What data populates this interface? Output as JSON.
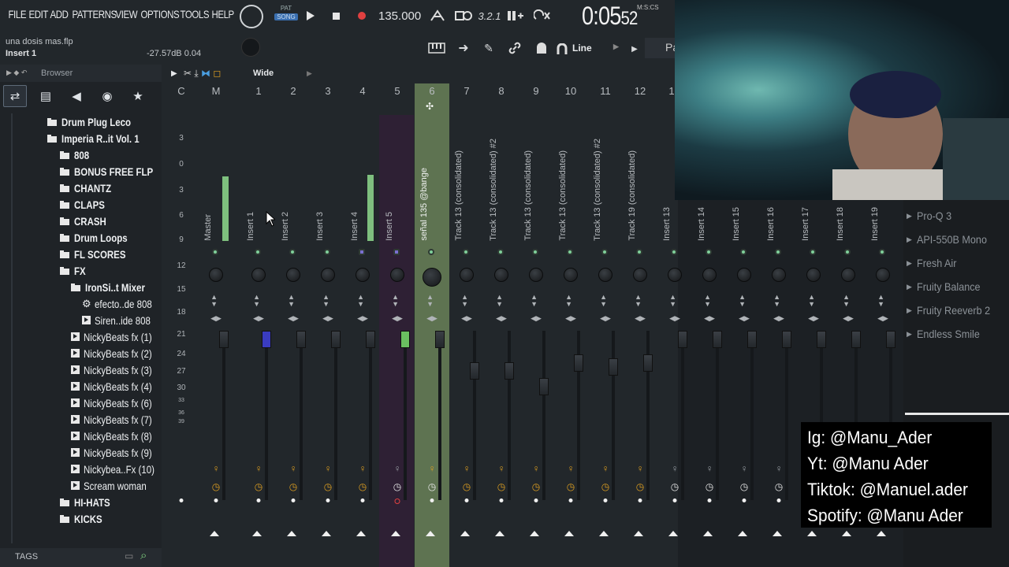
{
  "menu": [
    "FILE",
    "EDIT",
    "ADD",
    "PATTERNS",
    "VIEW",
    "OPTIONS",
    "TOOLS",
    "HELP"
  ],
  "transport": {
    "pat_label": "PAT",
    "song_label": "SONG",
    "tempo": "135.000",
    "time": "0:05",
    "time_sub": "52",
    "time_mode": "M:S:CS"
  },
  "hint": {
    "file": "una dosis mas.flp",
    "insert": "Insert 1",
    "db": "-27.57dB  0.04"
  },
  "toolbar2": {
    "snap": "Line",
    "truncated": "Pa"
  },
  "browser": {
    "title": "Browser",
    "items": [
      {
        "label": "Drum Plug Leco",
        "icon": "folder",
        "level": 1
      },
      {
        "label": "Imperia R..it Vol. 1",
        "icon": "folder",
        "level": 1
      },
      {
        "label": "808",
        "icon": "folder",
        "level": 2
      },
      {
        "label": "BONUS FREE FLP",
        "icon": "folder",
        "level": 2
      },
      {
        "label": "CHANTZ",
        "icon": "folder",
        "level": 2
      },
      {
        "label": "CLAPS",
        "icon": "folder",
        "level": 2
      },
      {
        "label": "CRASH",
        "icon": "folder",
        "level": 2
      },
      {
        "label": "Drum Loops",
        "icon": "folder",
        "level": 2
      },
      {
        "label": "FL SCORES",
        "icon": "folder",
        "level": 2
      },
      {
        "label": "FX",
        "icon": "folder",
        "level": 2
      },
      {
        "label": "IronSi..t Mixer",
        "icon": "folder",
        "level": 3
      },
      {
        "label": "efecto..de 808",
        "icon": "gear",
        "level": 4
      },
      {
        "label": "Siren..ide 808",
        "icon": "file",
        "level": 4
      },
      {
        "label": "NickyBeats fx (1)",
        "icon": "file",
        "level": 3
      },
      {
        "label": "NickyBeats fx (2)",
        "icon": "file",
        "level": 3
      },
      {
        "label": "NickyBeats fx (3)",
        "icon": "file",
        "level": 3
      },
      {
        "label": "NickyBeats fx (4)",
        "icon": "file",
        "level": 3
      },
      {
        "label": "NickyBeats fx (6)",
        "icon": "file",
        "level": 3
      },
      {
        "label": "NickyBeats fx (7)",
        "icon": "file",
        "level": 3
      },
      {
        "label": "NickyBeats fx (8)",
        "icon": "file",
        "level": 3
      },
      {
        "label": "NickyBeats fx (9)",
        "icon": "file",
        "level": 3
      },
      {
        "label": "Nickybea..Fx (10)",
        "icon": "file",
        "level": 3
      },
      {
        "label": "Scream woman",
        "icon": "file",
        "level": 3
      },
      {
        "label": "HI-HATS",
        "icon": "folder",
        "level": 2
      },
      {
        "label": "KICKS",
        "icon": "folder",
        "level": 2
      }
    ],
    "tags_label": "TAGS"
  },
  "mixer": {
    "view_mode": "Wide",
    "strip_numbers": [
      "C",
      "M",
      "1",
      "2",
      "3",
      "4",
      "5",
      "6",
      "7",
      "8",
      "9",
      "10",
      "11",
      "12",
      "1"
    ],
    "scale": [
      "3",
      "0",
      "3",
      "6",
      "9",
      "12",
      "15",
      "18",
      "21",
      "24",
      "27",
      "30",
      "33",
      "36",
      "39"
    ],
    "track_names": [
      "Master",
      "Insert 1",
      "Insert 2",
      "Insert 3",
      "Insert 4",
      "Insert 5",
      "señal 135 @bange",
      "Track 13 (consolidated)",
      "Track 13 (consolidated) #2",
      "Track 13 (consolidated)",
      "Track 13 (consolidated)",
      "Track 13 (consolidated) #2",
      "Track 19 (consolidated)",
      "Insert 13",
      "Insert 14",
      "Insert 15",
      "Insert 16",
      "Insert 17",
      "Insert 18",
      "Insert 19"
    ],
    "selected_strip": "6",
    "accent": "#5e7351"
  },
  "effects": [
    "Pro-Q 3",
    "API-550B Mono",
    "Fresh Air",
    "Fruity Balance",
    "Fruity Reeverb 2",
    "Endless Smile"
  ],
  "social": [
    "Ig: @Manu_Ader",
    "Yt: @Manu Ader",
    "Tiktok: @Manuel.ader",
    "Spotify: @Manu Ader"
  ]
}
